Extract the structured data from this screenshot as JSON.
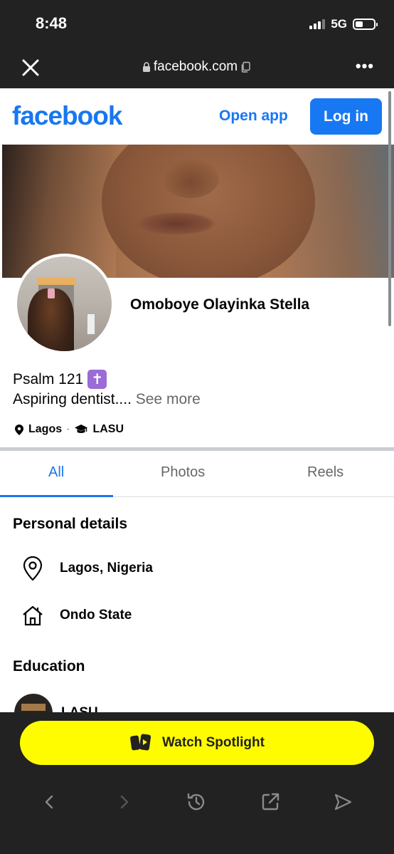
{
  "status_bar": {
    "time": "8:48",
    "network": "5G"
  },
  "browser": {
    "url": "facebook.com",
    "close_icon": "close-icon",
    "more_label": "•••"
  },
  "header": {
    "logo": "facebook",
    "open_app": "Open app",
    "login": "Log in"
  },
  "profile": {
    "name": "Omoboye Olayinka Stella",
    "bio_line1": "Psalm 121",
    "bio_line2": "Aspiring dentist.... ",
    "see_more": "See more",
    "location": "Lagos",
    "school": "LASU",
    "cross_emoji": "✝"
  },
  "tabs": [
    {
      "label": "All"
    },
    {
      "label": "Photos"
    },
    {
      "label": "Reels"
    }
  ],
  "personal_details": {
    "title": "Personal details",
    "items": [
      {
        "label": "Lagos, Nigeria",
        "icon": "location-pin-icon"
      },
      {
        "label": "Ondo State",
        "icon": "home-icon"
      }
    ]
  },
  "education": {
    "title": "Education",
    "school": "LASU"
  },
  "spotlight": {
    "label": "Watch Spotlight"
  },
  "colors": {
    "brand": "#1877f2",
    "spotlight": "#fffc00",
    "chrome": "#222222"
  }
}
